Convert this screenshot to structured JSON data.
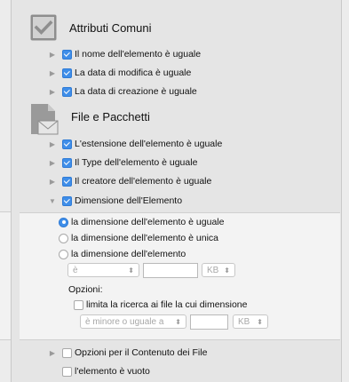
{
  "attributi": {
    "title": "Attributi Comuni",
    "items": [
      {
        "label": "Il nome dell'elemento è uguale"
      },
      {
        "label": "La data di modifica è uguale"
      },
      {
        "label": "La data di creazione è uguale"
      }
    ]
  },
  "file": {
    "title": "File e Pacchetti",
    "items": [
      {
        "label": "L'estensione dell'elemento è uguale"
      },
      {
        "label": "Il Type dell'elemento è uguale"
      },
      {
        "label": "Il creatore dell'elemento è uguale"
      },
      {
        "label": "Dimensione dell'Elemento"
      }
    ]
  },
  "size": {
    "radios": [
      {
        "label": "la dimensione dell'elemento è uguale",
        "selected": true
      },
      {
        "label": "la dimensione dell'elemento è unica",
        "selected": false
      },
      {
        "label": "la dimensione dell'elemento",
        "selected": false
      }
    ],
    "comparator": "è",
    "unit": "KB",
    "options_label": "Opzioni:",
    "limit_label": "limita la ricerca ai file la cui dimensione",
    "limit_comparator": "è minore o uguale a",
    "limit_unit": "KB"
  },
  "bottom": {
    "content_options": "Opzioni per il Contenuto dei File",
    "empty": "l'elemento è vuoto"
  },
  "colors": {
    "accent": "#3f8ee9"
  }
}
